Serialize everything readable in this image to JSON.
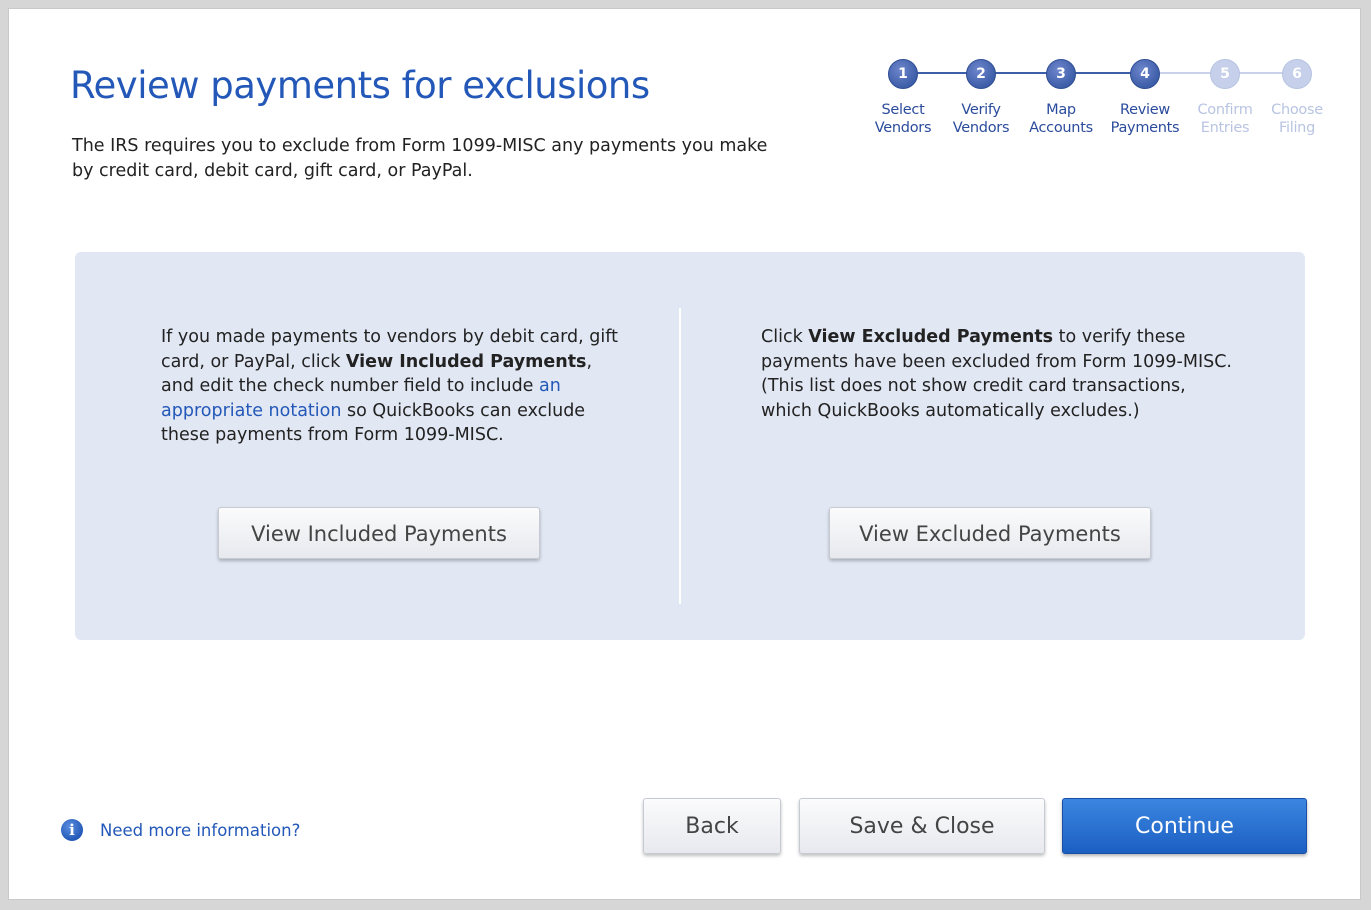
{
  "header": {
    "title": "Review payments for exclusions",
    "subtitle": "The IRS requires you to exclude from Form 1099-MISC any payments you make by credit card, debit card, gift card, or PayPal."
  },
  "stepper": {
    "steps": [
      {
        "number": "1",
        "line1": "Select",
        "line2": "Vendors",
        "status": "complete"
      },
      {
        "number": "2",
        "line1": "Verify",
        "line2": "Vendors",
        "status": "complete"
      },
      {
        "number": "3",
        "line1": "Map",
        "line2": "Accounts",
        "status": "complete"
      },
      {
        "number": "4",
        "line1": "Review",
        "line2": "Payments",
        "status": "current"
      },
      {
        "number": "5",
        "line1": "Confirm",
        "line2": "Entries",
        "status": "pending"
      },
      {
        "number": "6",
        "line1": "Choose",
        "line2": "Filing",
        "status": "pending"
      }
    ]
  },
  "panel": {
    "left": {
      "text_a": "If you made payments to vendors by debit card, gift card, or PayPal, click ",
      "bold": "View Included Payments",
      "text_b": ", and edit the check number field to include ",
      "link": "an appropriate notation",
      "text_c": " so QuickBooks can exclude these payments from Form 1099-MISC.",
      "button": "View Included Payments"
    },
    "right": {
      "text_a": "Click ",
      "bold": "View Excluded Payments",
      "text_b": " to verify these payments have been excluded from Form 1099-MISC. (This list does not show credit card transactions, which QuickBooks automatically excludes.)",
      "button": "View Excluded Payments"
    }
  },
  "footer": {
    "info_icon": "info-icon",
    "info_link": "Need more information?",
    "back": "Back",
    "save_close": "Save & Close",
    "continue": "Continue"
  },
  "colors": {
    "accent": "#2358b8",
    "step_active": "#3d5ea8",
    "step_pending": "#c6d0ea",
    "panel_bg": "#e1e7f3",
    "primary_button": "#2a6fd1"
  }
}
